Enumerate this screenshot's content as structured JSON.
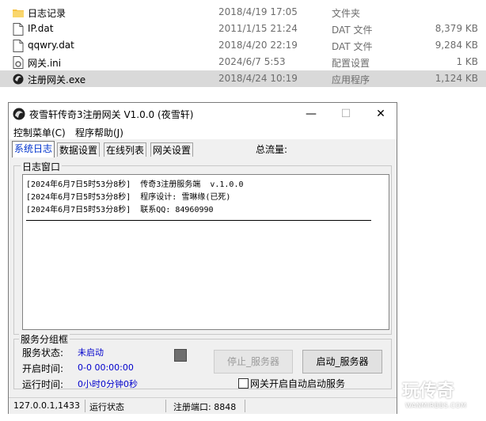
{
  "explorer": {
    "files": [
      {
        "name": "日志记录",
        "date": "2018/4/19 17:05",
        "type": "文件夹",
        "size": "",
        "icon": "folder-icon",
        "selected": false
      },
      {
        "name": "IP.dat",
        "date": "2011/1/15 21:24",
        "type": "DAT 文件",
        "size": "8,379 KB",
        "icon": "file-icon",
        "selected": false
      },
      {
        "name": "qqwry.dat",
        "date": "2018/4/20 22:19",
        "type": "DAT 文件",
        "size": "9,284 KB",
        "icon": "file-icon",
        "selected": false
      },
      {
        "name": "网关.ini",
        "date": "2024/6/7 5:53",
        "type": "配置设置",
        "size": "1 KB",
        "icon": "settings-file-icon",
        "selected": false
      },
      {
        "name": "注册网关.exe",
        "date": "2018/4/24 10:19",
        "type": "应用程序",
        "size": "1,124 KB",
        "icon": "app-icon",
        "selected": true
      }
    ]
  },
  "window": {
    "title": "夜雪轩传奇3注册网关 V1.0.0 (夜雪轩)",
    "minimize": "—",
    "maximize": "☐",
    "close": "✕"
  },
  "menu": {
    "control": "控制菜单(C)",
    "help": "程序帮助(J)"
  },
  "tabs": [
    {
      "label": "系统日志",
      "active": true
    },
    {
      "label": "数据设置",
      "active": false
    },
    {
      "label": "在线列表",
      "active": false
    },
    {
      "label": "网关设置",
      "active": false
    }
  ],
  "total_flow_label": "总流量:",
  "log": {
    "legend": "日志窗口",
    "lines": [
      "[2024年6月7日5时53分8秒]  传奇3注册服务端  v.1.0.0",
      "[2024年6月7日5时53分8秒]  程序设计: 雪琳缘(已死)",
      "[2024年6月7日5时53分8秒]  联系QQ: 84960990"
    ]
  },
  "service": {
    "legend": "服务分组框",
    "status_label": "服务状态:",
    "status_value": "未启动",
    "start_label": "开启时间:",
    "start_value": "0-0 00:00:00",
    "run_label": "运行时间:",
    "run_value": "0小时0分钟0秒",
    "stop_button": "停止_服务器",
    "start_button": "启动_服务器",
    "autostart_label": "网关开启自动启动服务",
    "autostart_checked": false
  },
  "statusbar": {
    "address": "127.0.0.1,1433",
    "state": "运行状态",
    "port": "注册端口: 8848"
  },
  "watermark": {
    "logo": "玩传奇",
    "site": "WANMIRBBS.COM"
  }
}
